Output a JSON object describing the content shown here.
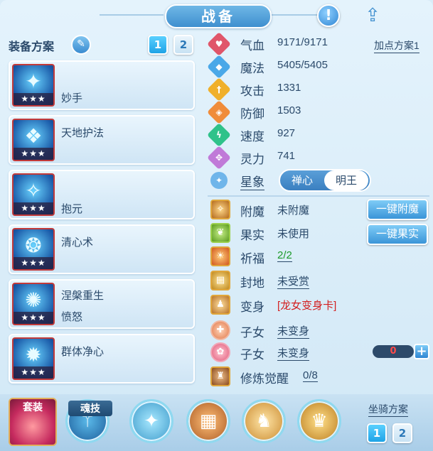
{
  "header": {
    "title": "战备",
    "info_icon": "!",
    "share_icon": "share-icon"
  },
  "left": {
    "scheme_label": "装备方案",
    "scheme_buttons": [
      "1",
      "2"
    ],
    "skills": [
      {
        "name": "妙手",
        "sub": "",
        "stars": "★★★",
        "icon": "✦"
      },
      {
        "name": "天地护法",
        "sub": "",
        "stars": "★★★",
        "icon": "❖"
      },
      {
        "name": "",
        "sub": "抱元",
        "stars": "★★★",
        "icon": "✧"
      },
      {
        "name": "清心术",
        "sub": "",
        "stars": "★★★",
        "icon": "❂"
      },
      {
        "name": "涅槃重生",
        "sub": "愤怒",
        "stars": "★★★",
        "icon": "✺"
      },
      {
        "name": "群体净心",
        "sub": "",
        "stars": "★★★",
        "icon": "✹"
      }
    ]
  },
  "stats": {
    "plan_link": "加点方案1",
    "rows": [
      {
        "label": "气血",
        "value": "9171/9171",
        "color": "#e0566a",
        "icon": "♥"
      },
      {
        "label": "魔法",
        "value": "5405/5405",
        "color": "#4aa8e8",
        "icon": "◆"
      },
      {
        "label": "攻击",
        "value": "1331",
        "color": "#f0b02a",
        "icon": "†"
      },
      {
        "label": "防御",
        "value": "1503",
        "color": "#f08c3a",
        "icon": "◈"
      },
      {
        "label": "速度",
        "value": "927",
        "color": "#2fc28a",
        "icon": "ϟ"
      },
      {
        "label": "灵力",
        "value": "741",
        "color": "#c07ad8",
        "icon": "✥"
      }
    ],
    "star_label": "星象",
    "star_options": [
      "禅心",
      "明王"
    ]
  },
  "functions": {
    "rows": [
      {
        "label": "附魔",
        "value": "未附魔",
        "style": ""
      },
      {
        "label": "果实",
        "value": "未使用",
        "style": ""
      },
      {
        "label": "祈福",
        "value": "2/2",
        "style": "green"
      },
      {
        "label": "封地",
        "value": "未受赏",
        "style": "u"
      },
      {
        "label": "变身",
        "value": "[龙女变身卡]",
        "style": "red"
      },
      {
        "label": "子女",
        "value": "未变身",
        "style": "u"
      },
      {
        "label": "子女",
        "value": "未变身",
        "style": "u"
      },
      {
        "label": "修炼觉醒",
        "value": "0/8",
        "style": "u"
      }
    ],
    "btn_enchant": "一键附魔",
    "btn_fruit": "一键果实",
    "stepper_value": "0",
    "stepper_plus": "+"
  },
  "bottom": {
    "suit_label": "套装",
    "soul_label": "魂技",
    "mount_label": "坐骑方案",
    "mount_buttons": [
      "1",
      "2"
    ]
  }
}
